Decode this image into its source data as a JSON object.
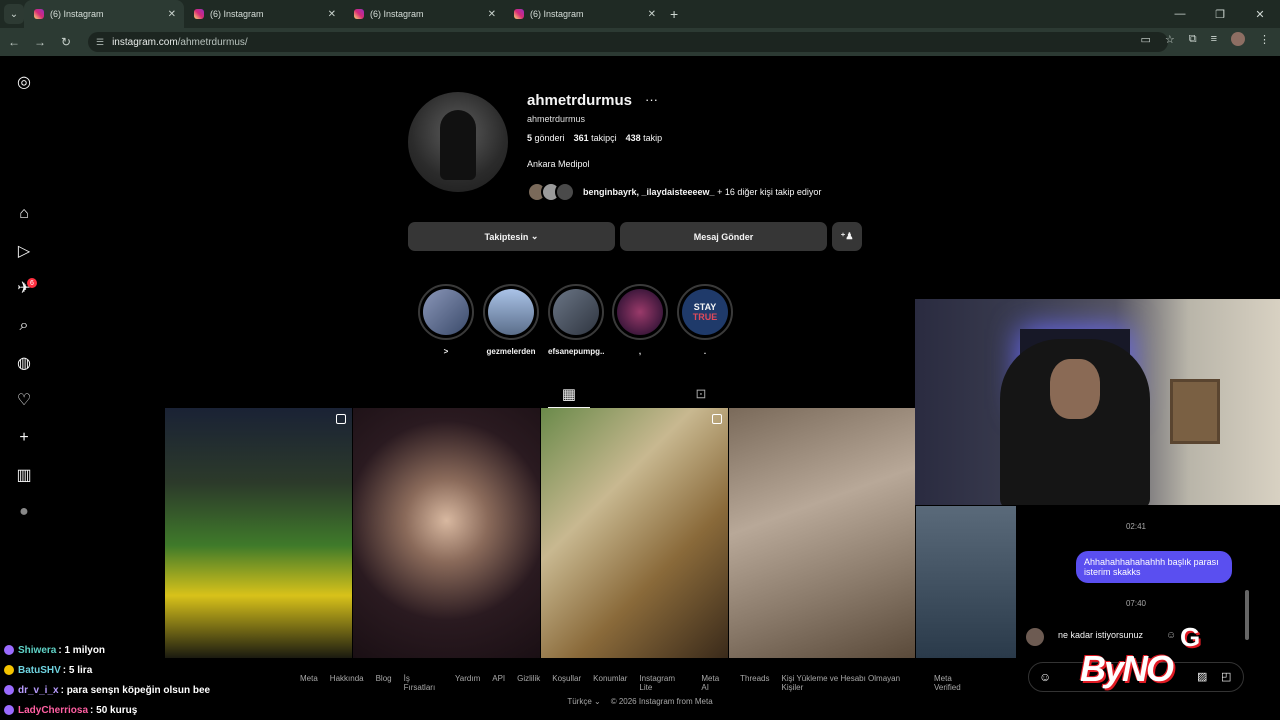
{
  "browser": {
    "tabs": [
      {
        "title": "(6) Instagram",
        "active": true
      },
      {
        "title": "(6) Instagram",
        "active": false
      },
      {
        "title": "(6) Instagram",
        "active": false
      },
      {
        "title": "(6) Instagram",
        "active": false
      }
    ],
    "url_host": "instagram.com",
    "url_path": "/ahmetrdurmus/"
  },
  "sidebar": {
    "notification_count": "6"
  },
  "profile": {
    "username": "ahmetrdurmus",
    "more": "···",
    "handle": "ahmetrdurmus",
    "posts_count": "5",
    "posts_label": "gönderi",
    "followers_count": "361",
    "followers_label": "takipçi",
    "following_count": "438",
    "following_label": "takip",
    "bio": "Ankara Medipol",
    "followed_by_names": "benginbayrk, _ilaydaisteeeew_",
    "followed_by_rest": "+ 16 diğer kişi takip ediyor",
    "follow_button": "Takiptesin",
    "message_button": "Mesaj Gönder"
  },
  "highlights": [
    {
      "label": ">",
      "color": "#6a7a9a"
    },
    {
      "label": "gezmelerden",
      "color": "#8aa3c8"
    },
    {
      "label": "efsanepumpg...",
      "color": "#556070"
    },
    {
      "label": ",",
      "color": "#4a2a5a"
    },
    {
      "label": ".",
      "color": "#1f3a6a"
    }
  ],
  "highlight_stay_text": "STAY",
  "highlight_true_text": "TRUE",
  "footer": {
    "links": [
      "Meta",
      "Hakkında",
      "Blog",
      "İş Fırsatları",
      "Yardım",
      "API",
      "Gizlilik",
      "Koşullar",
      "Konumlar",
      "Instagram Lite",
      "Meta AI",
      "Threads",
      "Kişi Yükleme ve Hesabı Olmayan Kişiler",
      "Meta Verified"
    ],
    "language": "Türkçe",
    "copyright": "© 2026 Instagram from Meta"
  },
  "chat": {
    "time1": "02:41",
    "outgoing": "Ahhahahhahahahhh başlık parası isterim skakks",
    "time2": "07:40",
    "incoming": "ne kadar istiyorsunuz"
  },
  "overlay": {
    "logo_text": "ByNO",
    "g_text": "G"
  },
  "stream_chat": [
    {
      "name": "Shiwera",
      "name_color": "#5fd3c7",
      "message": ": 1 milyon",
      "dot": "#9b6bff"
    },
    {
      "name": "BatuSHV",
      "name_color": "#6fd3e0",
      "message": ": 5 lira",
      "dot": "#f5c400"
    },
    {
      "name": "dr_v_i_x",
      "name_color": "#b99cff",
      "message": ": para senşn köpeğin olsun bee",
      "dot": "#9b6bff"
    },
    {
      "name": "LadyCherriosa",
      "name_color": "#ff5fa2",
      "message": ": 50 kuruş",
      "dot": "#9b6bff"
    }
  ]
}
